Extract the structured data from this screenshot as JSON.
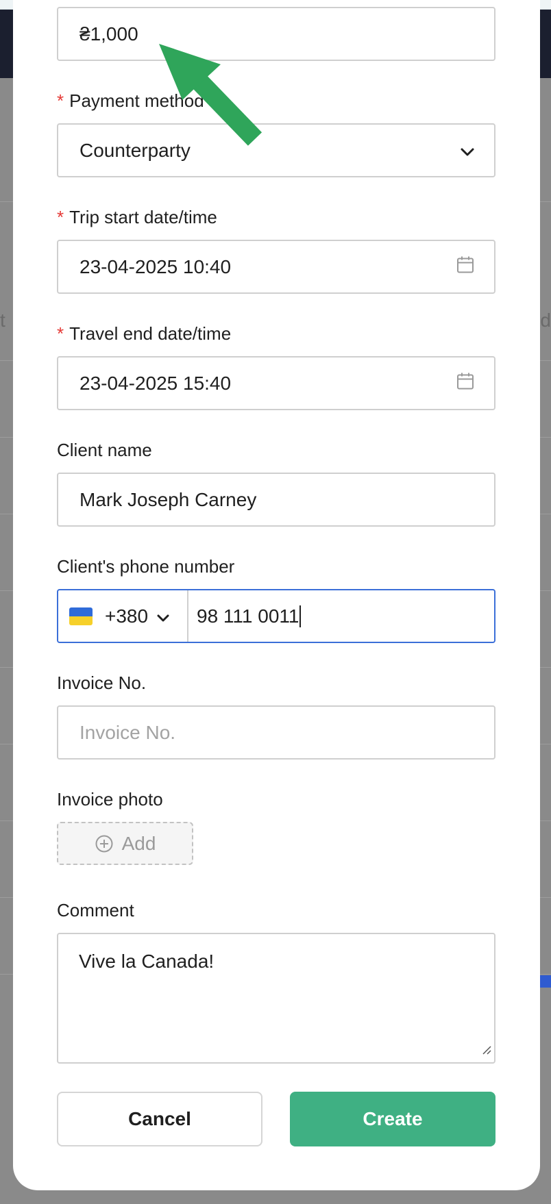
{
  "form": {
    "amount": {
      "value": "₴1,000"
    },
    "payment_method": {
      "label": "Payment method",
      "value": "Counterparty"
    },
    "trip_start": {
      "label": "Trip start date/time",
      "value": "23-04-2025 10:40"
    },
    "travel_end": {
      "label": "Travel end date/time",
      "value": "23-04-2025 15:40"
    },
    "client_name": {
      "label": "Client name",
      "value": "Mark Joseph Carney"
    },
    "client_phone": {
      "label": "Client's phone number",
      "country_code": "+380",
      "number": "98 111 0011"
    },
    "invoice_no": {
      "label": "Invoice No.",
      "value": "",
      "placeholder": "Invoice No."
    },
    "invoice_photo": {
      "label": "Invoice photo",
      "add_label": "Add"
    },
    "comment": {
      "label": "Comment",
      "value": "Vive la Canada!"
    }
  },
  "actions": {
    "cancel_label": "Cancel",
    "create_label": "Create"
  },
  "background_fragments": {
    "left": "t",
    "right": "d"
  },
  "colors": {
    "primary": "#3fb083",
    "focus": "#3b6fd8",
    "required": "#e53935",
    "annotation_arrow": "#2fa55a"
  }
}
